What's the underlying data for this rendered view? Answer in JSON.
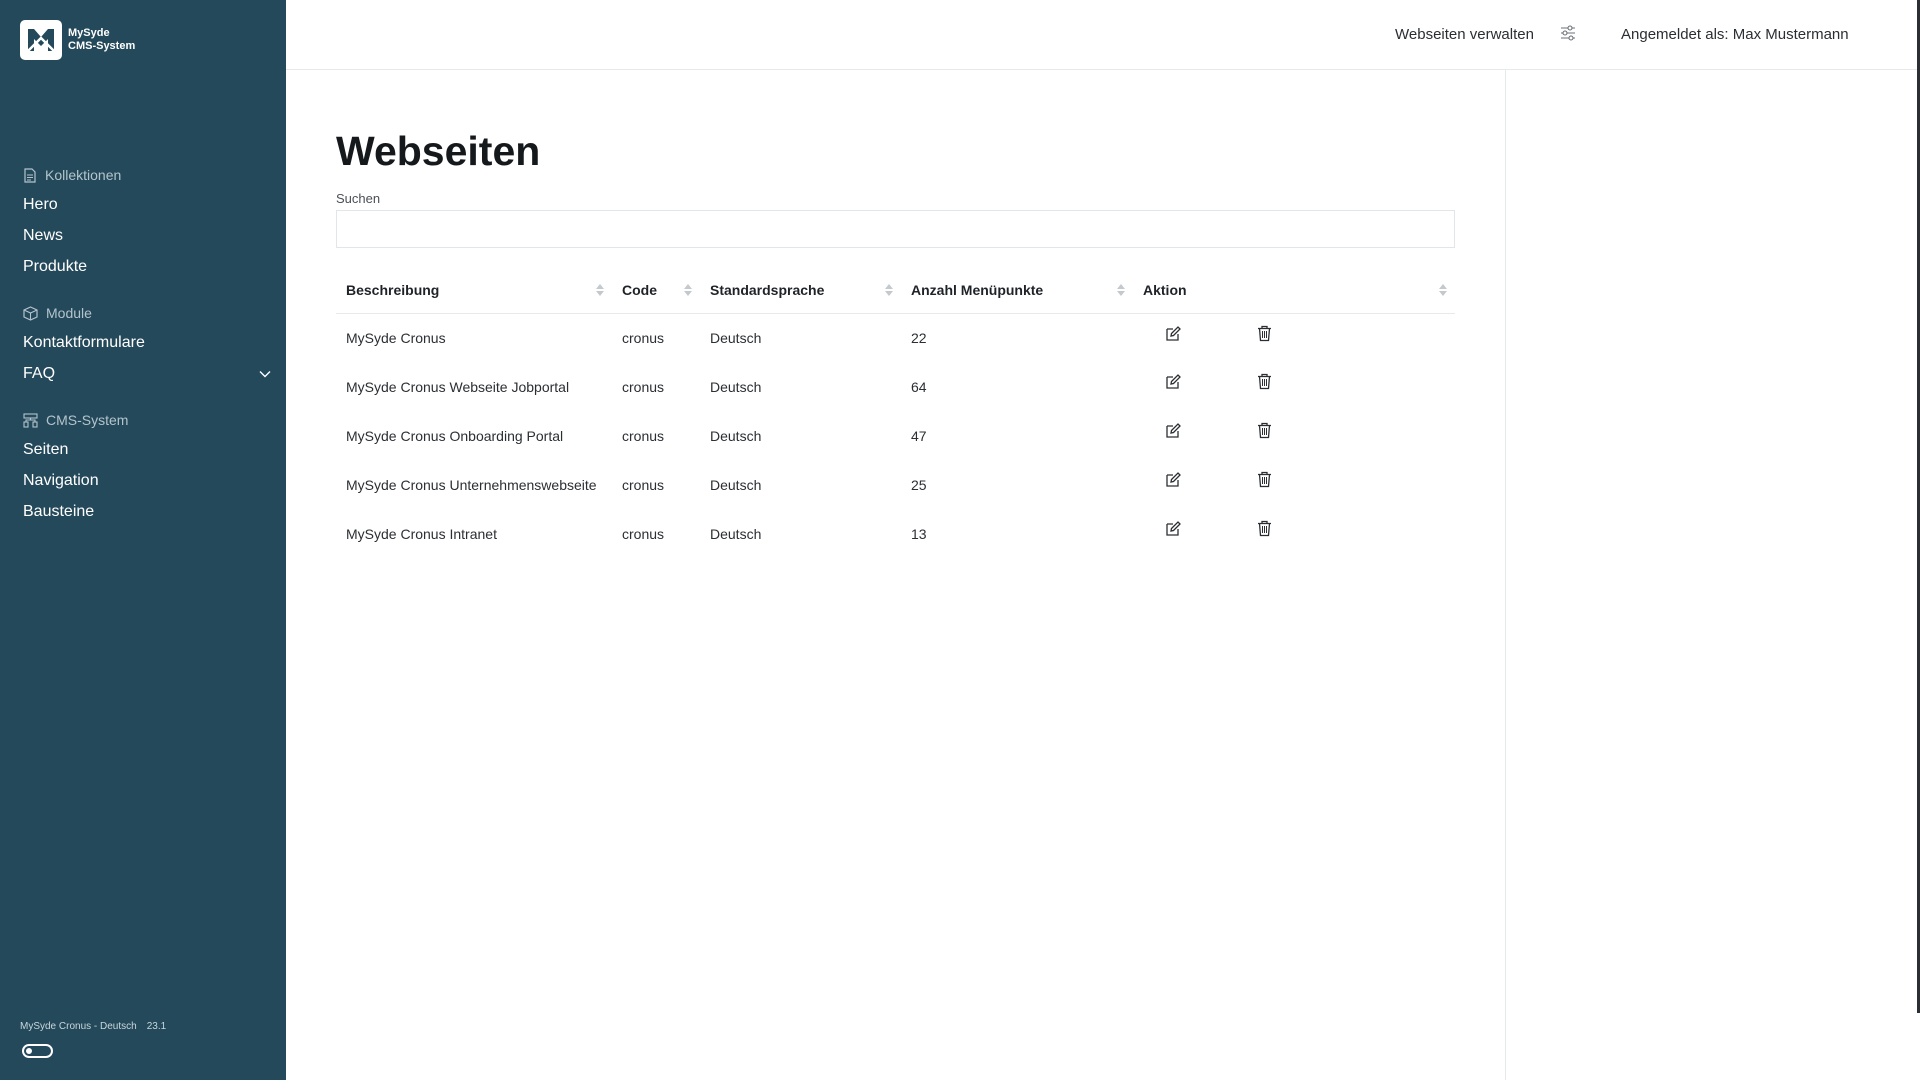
{
  "brand": {
    "line1": "MySyde",
    "line2": "CMS-System"
  },
  "sidebar": {
    "sections": [
      {
        "title": "Kollektionen",
        "icon": "document-icon",
        "items": [
          "Hero",
          "News",
          "Produkte"
        ]
      },
      {
        "title": "Module",
        "icon": "box-icon",
        "items": [
          "Kontaktformulare",
          "FAQ"
        ]
      },
      {
        "title": "CMS-System",
        "icon": "sitemap-icon",
        "items": [
          "Seiten",
          "Navigation",
          "Bausteine"
        ]
      }
    ],
    "footer": {
      "site": "MySyde Cronus - Deutsch",
      "version": "23.1"
    }
  },
  "topbar": {
    "manage_label": "Webseiten verwalten",
    "user_label": "Angemeldet als: Max Mustermann"
  },
  "main": {
    "title": "Webseiten",
    "search_label": "Suchen",
    "search_value": "",
    "columns": [
      "Beschreibung",
      "Code",
      "Standardsprache",
      "Anzahl Menüpunkte",
      "Aktion"
    ],
    "rows": [
      {
        "beschreibung": "MySyde Cronus",
        "code": "cronus",
        "sprache": "Deutsch",
        "anzahl": "22"
      },
      {
        "beschreibung": "MySyde Cronus Webseite Jobportal",
        "code": "cronus",
        "sprache": "Deutsch",
        "anzahl": "64"
      },
      {
        "beschreibung": "MySyde Cronus Onboarding Portal",
        "code": "cronus",
        "sprache": "Deutsch",
        "anzahl": "47"
      },
      {
        "beschreibung": "MySyde Cronus Unternehmenswebseite",
        "code": "cronus",
        "sprache": "Deutsch",
        "anzahl": "25"
      },
      {
        "beschreibung": "MySyde Cronus Intranet",
        "code": "cronus",
        "sprache": "Deutsch",
        "anzahl": "13"
      }
    ]
  },
  "colors": {
    "sidebar_bg": "#24495b",
    "accent": "#24495b"
  }
}
